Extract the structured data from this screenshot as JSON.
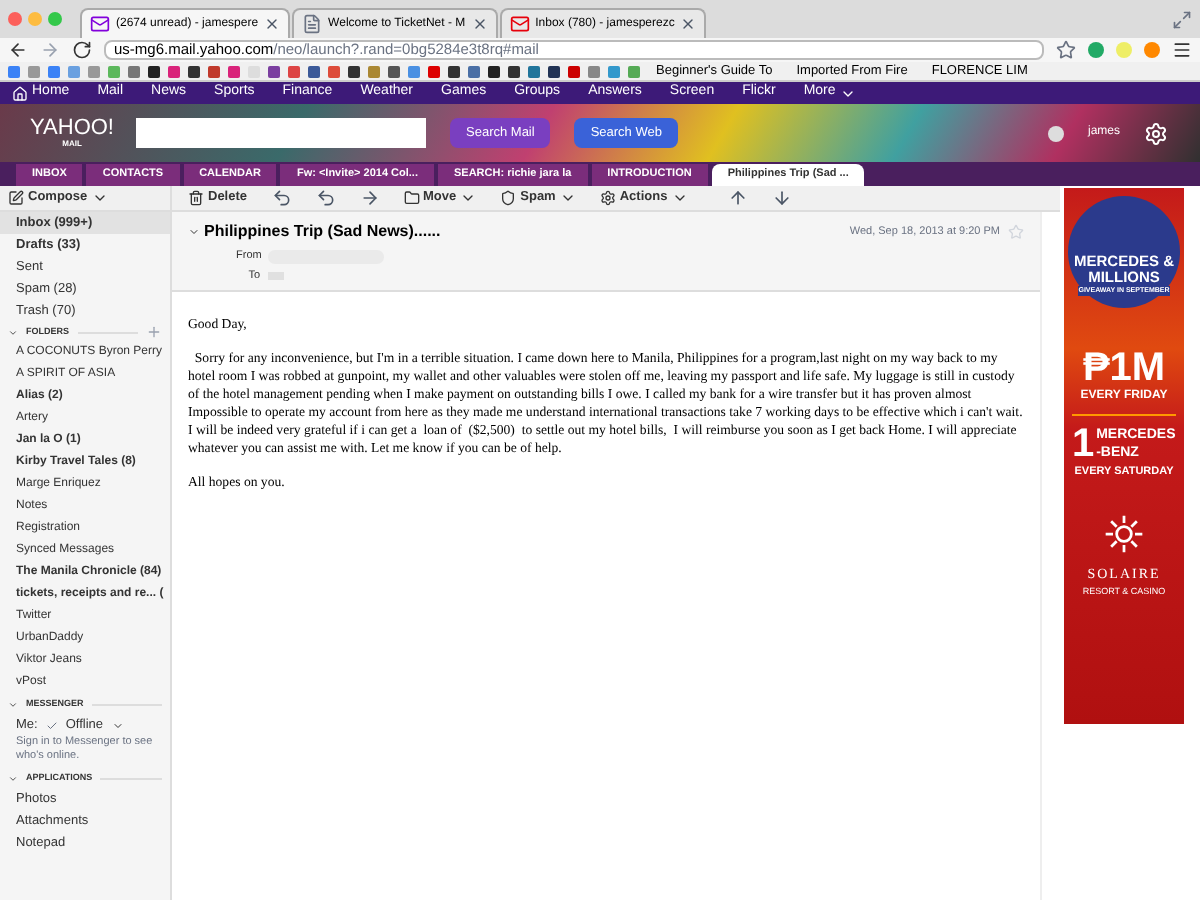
{
  "browser_tabs": [
    {
      "title": "(2674 unread) - jamespere",
      "kind": "mail",
      "selected": true
    },
    {
      "title": "Welcome to TicketNet - M",
      "kind": "page",
      "selected": false
    },
    {
      "title": "Inbox (780) - jamesperezc",
      "kind": "gmail",
      "selected": false
    }
  ],
  "address": {
    "host": "us-mg6.mail.yahoo.com",
    "path": "/neo/launch?.rand=0bg5284e3t8rq#mail"
  },
  "bookmarks": [
    "Beginner's Guide To",
    "Imported From Fire",
    "FLORENCE LIM"
  ],
  "nav": [
    "Home",
    "Mail",
    "News",
    "Sports",
    "Finance",
    "Weather",
    "Games",
    "Groups",
    "Answers",
    "Screen",
    "Flickr",
    "More"
  ],
  "header": {
    "logo": "YAHOO!",
    "logo_sub": "MAIL",
    "search_mail": "Search Mail",
    "search_web": "Search Web",
    "user": "james"
  },
  "mail_tabs": [
    {
      "label": "INBOX",
      "selected": false
    },
    {
      "label": "CONTACTS",
      "selected": false
    },
    {
      "label": "CALENDAR",
      "selected": false
    },
    {
      "label": "Fw: <Invite> 2014 Col...",
      "selected": false
    },
    {
      "label": "SEARCH: richie jara la",
      "selected": false
    },
    {
      "label": "INTRODUCTION",
      "selected": false
    },
    {
      "label": "Philippines Trip (Sad ...",
      "selected": true
    }
  ],
  "toolbar": {
    "compose": "Compose",
    "delete": "Delete",
    "move": "Move",
    "spam": "Spam",
    "actions": "Actions"
  },
  "sidebar": {
    "main": [
      {
        "label": "Inbox (999+)",
        "bold": true,
        "selected": true
      },
      {
        "label": "Drafts (33)",
        "bold": true,
        "selected": false
      },
      {
        "label": "Sent",
        "bold": false,
        "selected": false
      },
      {
        "label": "Spam (28)",
        "bold": false,
        "selected": false
      },
      {
        "label": "Trash (70)",
        "bold": false,
        "selected": false
      }
    ],
    "folders_heading": "FOLDERS",
    "folders": [
      {
        "label": "A COCONUTS Byron Perry",
        "bold": false
      },
      {
        "label": "A SPIRIT OF ASIA",
        "bold": false
      },
      {
        "label": "Alias (2)",
        "bold": true
      },
      {
        "label": "Artery",
        "bold": false
      },
      {
        "label": "Jan la O (1)",
        "bold": true
      },
      {
        "label": "Kirby Travel Tales (8)",
        "bold": true
      },
      {
        "label": "Marge Enriquez",
        "bold": false
      },
      {
        "label": "Notes",
        "bold": false
      },
      {
        "label": "Registration",
        "bold": false
      },
      {
        "label": "Synced Messages",
        "bold": false
      },
      {
        "label": "The Manila Chronicle (84)",
        "bold": true
      },
      {
        "label": "tickets, receipts and re... (",
        "bold": true
      },
      {
        "label": "Twitter",
        "bold": false
      },
      {
        "label": "UrbanDaddy",
        "bold": false
      },
      {
        "label": "Viktor Jeans",
        "bold": false
      },
      {
        "label": "vPost",
        "bold": false
      }
    ],
    "messenger_heading": "MESSENGER",
    "me": "Me:",
    "status": "Offline",
    "messenger_note": "Sign in to Messenger to see who's online.",
    "applications_heading": "APPLICATIONS",
    "applications": [
      "Photos",
      "Attachments",
      "Notepad"
    ]
  },
  "message": {
    "subject": "Philippines Trip (Sad News)......",
    "from_label": "From",
    "to_label": "To",
    "date": "Wed, Sep 18, 2013 at 9:20 PM",
    "body": [
      "Good Day,",
      "  Sorry for any inconvenience, but I'm in a terrible situation. I came down here to Manila, Philippines for a program,last night on my way back to my hotel room I was robbed at gunpoint, my wallet and other valuables were stolen off me, leaving my passport and life safe. My luggage is still in custody of the hotel management pending when I make payment on outstanding bills I owe. I called my bank for a wire transfer but it has proven almost Impossible to operate my account from here as they made me understand international transactions take 7 working days to be effective which i can't wait. I will be indeed very grateful if i can get a  loan of  ($2,500)  to settle out my hotel bills,  I will reimburse you soon as I get back Home. I will appreciate whatever you can assist me with. Let me know if you can be of help.",
      "All hopes on you."
    ]
  },
  "ad": {
    "title": "MERCEDES & MILLIONS",
    "subtitle": "GIVEAWAY IN SEPTEMBER",
    "prize1": "₱1M",
    "prize1_when": "EVERY FRIDAY",
    "prize2_num": "1",
    "prize2": "MERCEDES -BENZ",
    "prize2_when": "EVERY SATURDAY",
    "brand": "SOLAIRE",
    "brand_sub": "RESORT & CASINO"
  }
}
